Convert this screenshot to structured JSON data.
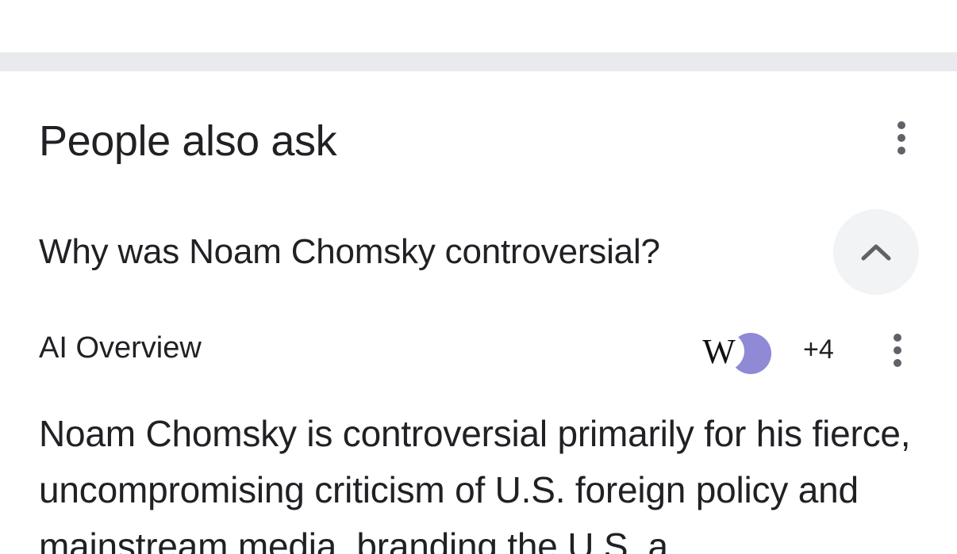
{
  "people_also_ask": {
    "title": "People also ask",
    "menu_icon": "more-vert-icon",
    "question": "Why was Noam Chomsky controversial?",
    "collapse_icon": "chevron-up-icon"
  },
  "ai_overview": {
    "label": "AI Overview",
    "sources": [
      {
        "icon": "wikipedia-icon",
        "glyph": "W"
      },
      {
        "icon": "source-avatar-icon"
      }
    ],
    "more_sources": "+4",
    "menu_icon": "more-vert-icon",
    "text": "Noam Chomsky is controversial primarily for his fierce, uncompromising criticism of U.S. foreign policy and mainstream media, branding the U.S. a"
  },
  "colors": {
    "divider": "#e8eaed",
    "button_bg": "#f1f3f4",
    "icon_grey": "#5f6368",
    "avatar_purple": "#8e8ad6",
    "text": "#202124"
  }
}
